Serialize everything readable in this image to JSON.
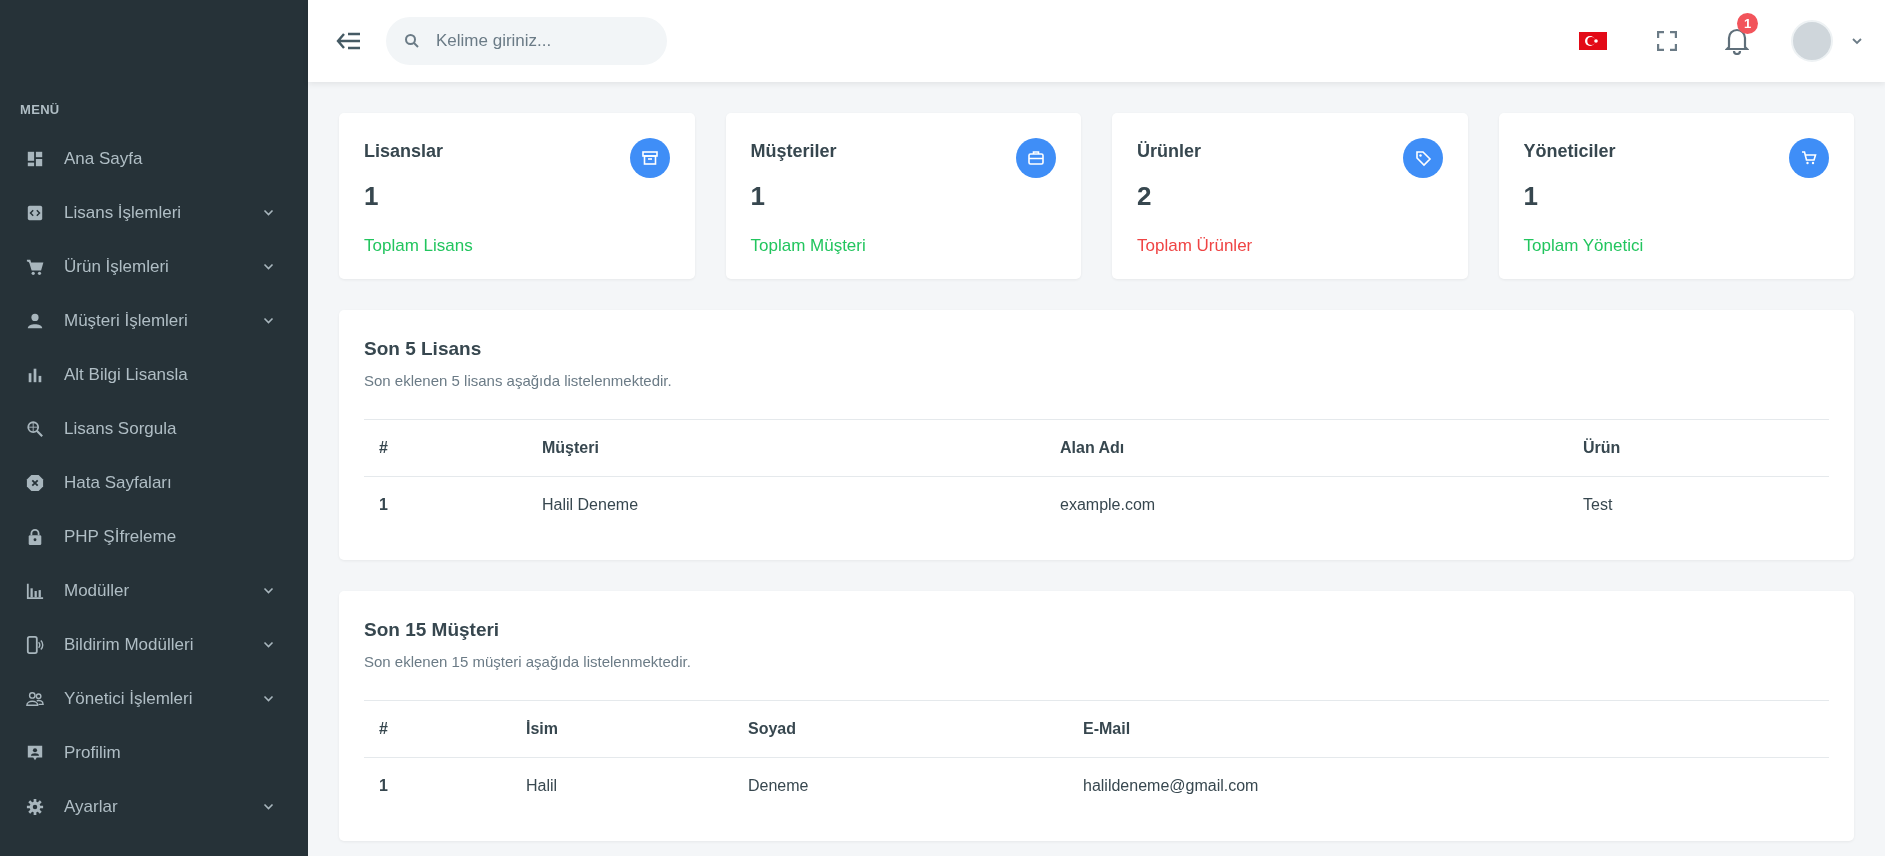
{
  "header": {
    "search": {
      "placeholder": "Kelime giriniz..."
    },
    "notifications": {
      "count": "1"
    }
  },
  "sidebar": {
    "heading": "MENÜ",
    "items": [
      {
        "label": "Ana Sayfa",
        "has_submenu": false
      },
      {
        "label": "Lisans İşlemleri",
        "has_submenu": true
      },
      {
        "label": "Ürün İşlemleri",
        "has_submenu": true
      },
      {
        "label": "Müşteri İşlemleri",
        "has_submenu": true
      },
      {
        "label": "Alt Bilgi Lisansla",
        "has_submenu": false
      },
      {
        "label": "Lisans Sorgula",
        "has_submenu": false
      },
      {
        "label": "Hata Sayfaları",
        "has_submenu": false
      },
      {
        "label": "PHP Şİfreleme",
        "has_submenu": false
      },
      {
        "label": "Modüller",
        "has_submenu": true
      },
      {
        "label": "Bildirim Modülleri",
        "has_submenu": true
      },
      {
        "label": "Yönetici İşlemleri",
        "has_submenu": true
      },
      {
        "label": "Profilim",
        "has_submenu": false
      },
      {
        "label": "Ayarlar",
        "has_submenu": true
      }
    ]
  },
  "stats": [
    {
      "title": "Lisanslar",
      "value": "1",
      "footer": "Toplam Lisans",
      "color": "#22c55e"
    },
    {
      "title": "Müşteriler",
      "value": "1",
      "footer": "Toplam Müşteri",
      "color": "#22c55e"
    },
    {
      "title": "Ürünler",
      "value": "2",
      "footer": "Toplam Ürünler",
      "color": "#ef4444"
    },
    {
      "title": "Yöneticiler",
      "value": "1",
      "footer": "Toplam Yönetici",
      "color": "#22c55e"
    }
  ],
  "tables": [
    {
      "title": "Son 5 Lisans",
      "subtitle": "Son eklenen 5 lisans aşağıda listelenmektedir.",
      "columns": [
        "#",
        "Müşteri",
        "Alan Adı",
        "Ürün"
      ],
      "rows": [
        [
          "1",
          "Halil Deneme",
          "example.com",
          "Test"
        ]
      ]
    },
    {
      "title": "Son 15 Müşteri",
      "subtitle": "Son eklenen 15 müşteri aşağıda listelenmektedir.",
      "columns": [
        "#",
        "İsim",
        "Soyad",
        "E-Mail"
      ],
      "rows": [
        [
          "1",
          "Halil",
          "Deneme",
          "halildeneme@gmail.com"
        ]
      ]
    }
  ]
}
